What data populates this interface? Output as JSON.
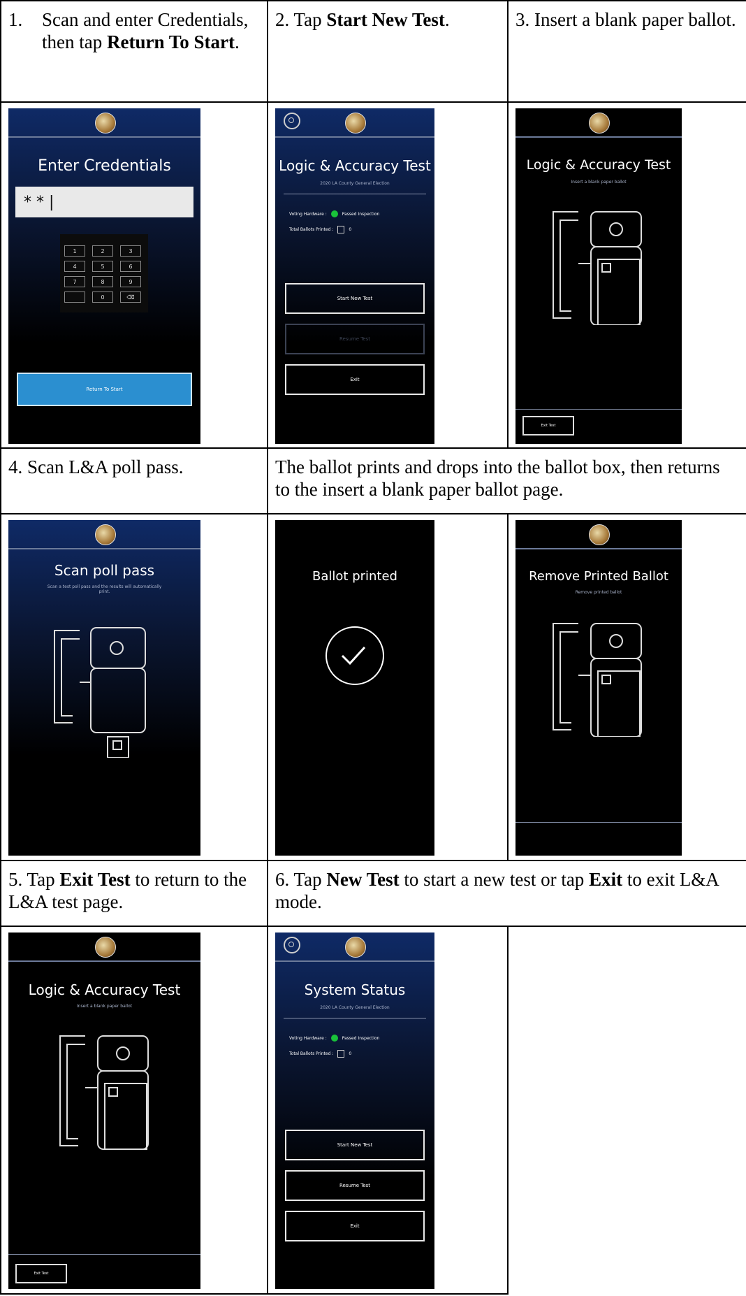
{
  "rows": {
    "r1": {
      "step1": {
        "num": "1.",
        "pre": "Scan and enter Credentials, then tap ",
        "bold": "Return To Start",
        "post": "."
      },
      "step2": {
        "pre": "2. Tap ",
        "bold": "Start New Test",
        "post": "."
      },
      "step3": {
        "text": "3. Insert a blank paper ballot."
      }
    },
    "r3": {
      "step4": {
        "text": "4. Scan L&A poll pass."
      },
      "note": {
        "text": "The ballot prints and drops into the ballot box, then returns to the insert a blank paper ballot page."
      }
    },
    "r5": {
      "step5": {
        "pre": "5. Tap ",
        "bold": "Exit Test",
        "post": " to return to the L&A test page."
      },
      "step6": {
        "pre": "6. Tap ",
        "bold": "New Test",
        "post": " to start a new test or tap ",
        "bold2": "Exit",
        "post2": " to exit L&A mode."
      }
    }
  },
  "screens": {
    "credentials": {
      "title": "Enter Credentials",
      "input_value": "* * |",
      "keys": [
        "1",
        "2",
        "3",
        "4",
        "5",
        "6",
        "7",
        "8",
        "9",
        "",
        "0",
        "⌫"
      ],
      "button": "Return To Start"
    },
    "la_test": {
      "title": "Logic & Accuracy Test",
      "subtitle": "2020 LA County General Election",
      "hardware_label": "Voting Hardware :",
      "hardware_value": "Passed Inspection",
      "printed_label": "Total Ballots Printed :",
      "printed_value": "0",
      "buttons": [
        "Start New Test",
        "Resume Test",
        "Exit"
      ]
    },
    "insert_ballot": {
      "title": "Logic & Accuracy Test",
      "subtitle": "Insert a blank paper ballot",
      "exit_button": "Exit Test"
    },
    "scan_pass": {
      "title": "Scan poll pass",
      "subtitle": "Scan a test poll pass and the results will automatically print."
    },
    "printed": {
      "title": "Ballot printed"
    },
    "remove": {
      "title": "Remove Printed Ballot",
      "subtitle": "Remove printed ballot"
    },
    "exit_test": {
      "title": "Logic & Accuracy Test",
      "subtitle": "Insert a blank paper ballot",
      "exit_button": "Exit Test"
    },
    "system_status": {
      "title": "System Status",
      "subtitle": "2020 LA County General Election",
      "hardware_label": "Voting Hardware :",
      "hardware_value": "Passed Inspection",
      "printed_label": "Total Ballots Printed :",
      "printed_value": "0",
      "buttons": [
        "Start New Test",
        "Resume Test",
        "Exit"
      ]
    }
  },
  "colors": {
    "gradient_top": "#0f2a66",
    "accent_blue": "#2b8fd0",
    "status_green": "#19c23a"
  }
}
